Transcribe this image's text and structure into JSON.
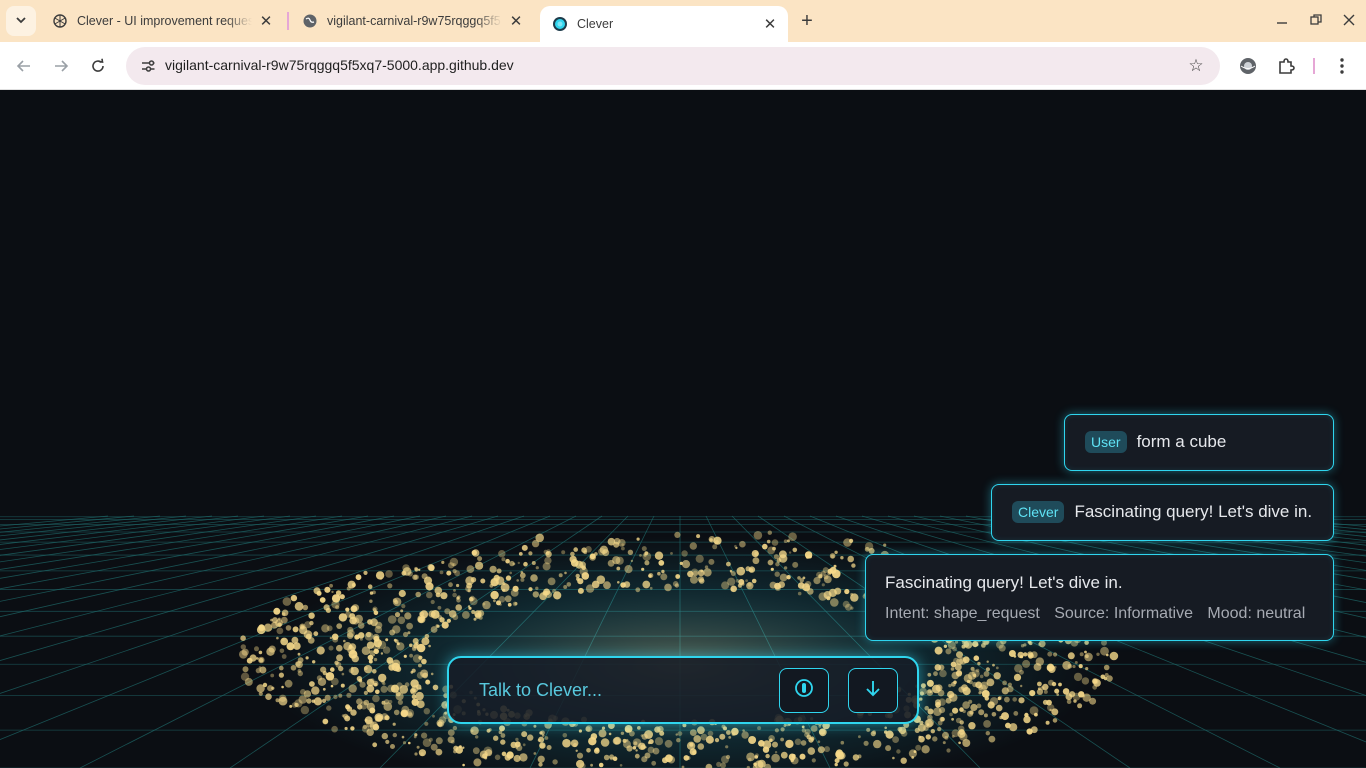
{
  "browser": {
    "tabs": [
      {
        "title": "Clever - UI improvement reques",
        "icon": "chatgpt-icon"
      },
      {
        "title": "vigilant-carnival-r9w75rqggq5f5",
        "icon": "globe-icon"
      },
      {
        "title": "Clever",
        "icon": "clever-favicon-icon",
        "active": true
      }
    ],
    "url": "vigilant-carnival-r9w75rqggq5f5xq7-5000.app.github.dev"
  },
  "chat": {
    "user_badge": "User",
    "user_message": "form a cube",
    "clever_badge": "Clever",
    "clever_message": "Fascinating query! Let's dive in.",
    "detail": {
      "text": "Fascinating query! Let's dive in.",
      "intent": "Intent: shape_request",
      "source": "Source: Informative",
      "mood": "Mood: neutral"
    }
  },
  "input": {
    "placeholder": "Talk to Clever..."
  },
  "colors": {
    "accent": "#2fd5ee",
    "background": "#0b0e13",
    "particles": "#f6d98a",
    "grid": "#1f6d6e"
  }
}
